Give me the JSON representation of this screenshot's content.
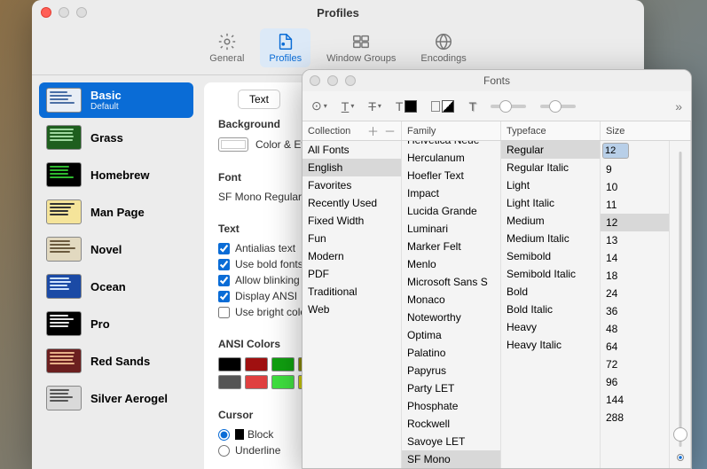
{
  "profiles_window": {
    "title": "Profiles",
    "toolbar": [
      {
        "id": "general",
        "label": "General"
      },
      {
        "id": "profiles",
        "label": "Profiles",
        "selected": true
      },
      {
        "id": "window-groups",
        "label": "Window Groups"
      },
      {
        "id": "encodings",
        "label": "Encodings"
      }
    ],
    "profiles": [
      {
        "name": "Basic",
        "sub": "Default",
        "bg": "#e8eef5",
        "line": "#4a6fa5",
        "selected": true
      },
      {
        "name": "Grass",
        "bg": "#1e5e1e",
        "line": "#9fd89f"
      },
      {
        "name": "Homebrew",
        "bg": "#000000",
        "line": "#2fb82f"
      },
      {
        "name": "Man Page",
        "bg": "#f5e49a",
        "line": "#333"
      },
      {
        "name": "Novel",
        "bg": "#e2d9c0",
        "line": "#6b5a3e"
      },
      {
        "name": "Ocean",
        "bg": "#1b4aa5",
        "line": "#cfe3ff"
      },
      {
        "name": "Pro",
        "bg": "#000000",
        "line": "#e5e5e5"
      },
      {
        "name": "Red Sands",
        "bg": "#6b1f1f",
        "line": "#e6b088"
      },
      {
        "name": "Silver Aerogel",
        "bg": "#d9d9d9",
        "line": "#555"
      }
    ],
    "settings": {
      "tab": "Text",
      "background_label": "Background",
      "color_effects_label": "Color & Effects",
      "font_label": "Font",
      "font_value": "SF Mono Regular",
      "text_label": "Text",
      "antialias": {
        "label": "Antialias text",
        "checked": true
      },
      "bold_fonts": {
        "label": "Use bold fonts",
        "checked": true
      },
      "blinking": {
        "label": "Allow blinking",
        "checked": true
      },
      "ansi": {
        "label": "Display ANSI",
        "checked": true
      },
      "bright": {
        "label": "Use bright colors",
        "checked": false
      },
      "ansi_colors_label": "ANSI Colors",
      "ansi_colors_row1": [
        "#000000",
        "#a01010",
        "#10a010",
        "#888800"
      ],
      "ansi_colors_row2": [
        "#555555",
        "#e04040",
        "#40e040",
        "#cccc00"
      ],
      "cursor_label": "Cursor",
      "cursor_block": {
        "label": "Block",
        "checked": true
      },
      "cursor_underline": {
        "label": "Underline",
        "checked": false
      }
    }
  },
  "fonts_window": {
    "title": "Fonts",
    "headers": {
      "collection": "Collection",
      "family": "Family",
      "typeface": "Typeface",
      "size": "Size"
    },
    "collections": [
      "All Fonts",
      "English",
      "Favorites",
      "Recently Used",
      "Fixed Width",
      "Fun",
      "Modern",
      "PDF",
      "Traditional",
      "Web"
    ],
    "collection_selected": "English",
    "families": [
      "Helvetica Neue",
      "Herculanum",
      "Hoefler Text",
      "Impact",
      "Lucida Grande",
      "Luminari",
      "Marker Felt",
      "Menlo",
      "Microsoft Sans S",
      "Monaco",
      "Noteworthy",
      "Optima",
      "Palatino",
      "Papyrus",
      "Party LET",
      "Phosphate",
      "Rockwell",
      "Savoye LET",
      "SF Mono"
    ],
    "family_selected": "SF Mono",
    "typefaces": [
      "Regular",
      "Regular Italic",
      "Light",
      "Light Italic",
      "Medium",
      "Medium Italic",
      "Semibold",
      "Semibold Italic",
      "Bold",
      "Bold Italic",
      "Heavy",
      "Heavy Italic"
    ],
    "typeface_selected": "Regular",
    "sizes": [
      "9",
      "10",
      "11",
      "12",
      "13",
      "14",
      "18",
      "24",
      "36",
      "48",
      "64",
      "72",
      "96",
      "144",
      "288"
    ],
    "size_value": "12",
    "size_selected": "12"
  }
}
